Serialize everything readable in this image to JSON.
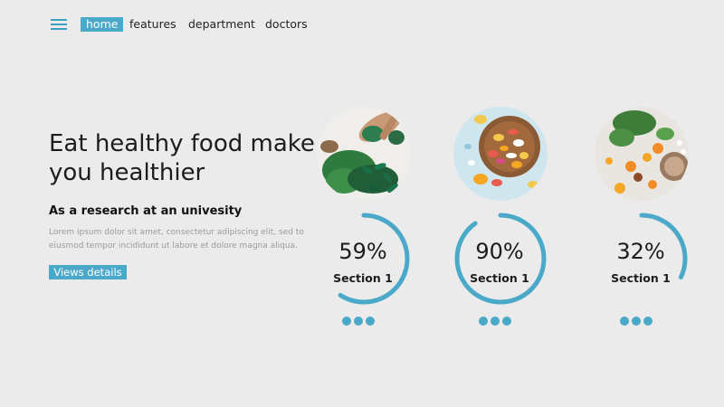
{
  "nav": {
    "items": [
      {
        "label": "home",
        "active": true
      },
      {
        "label": "features",
        "active": false
      },
      {
        "label": "department",
        "active": false
      },
      {
        "label": "doctors",
        "active": false
      }
    ]
  },
  "hero": {
    "headline": "Eat healthy food make you healthier",
    "subheading": "As a research  at an univesity",
    "body": "Lorem ipsum dolor sit amet, consectetur adipiscing elit, sed to eiusmod tempor incididunt ut labore et dolore magna aliqua.",
    "cta_label": "Views details"
  },
  "cards": [
    {
      "percent": 59,
      "percent_label": "59%",
      "label": "Section 1",
      "photo": "capsules-and-greens-photo"
    },
    {
      "percent": 90,
      "percent_label": "90%",
      "label": "Section 1",
      "photo": "colorful-pills-bowl-photo"
    },
    {
      "percent": 32,
      "percent_label": "32%",
      "label": "Section 1",
      "photo": "fruits-and-herbs-photo"
    }
  ],
  "colors": {
    "accent": "#4aa9c8",
    "background": "#ebebec",
    "text": "#1c1c1c",
    "muted": "#9a9a9a"
  }
}
